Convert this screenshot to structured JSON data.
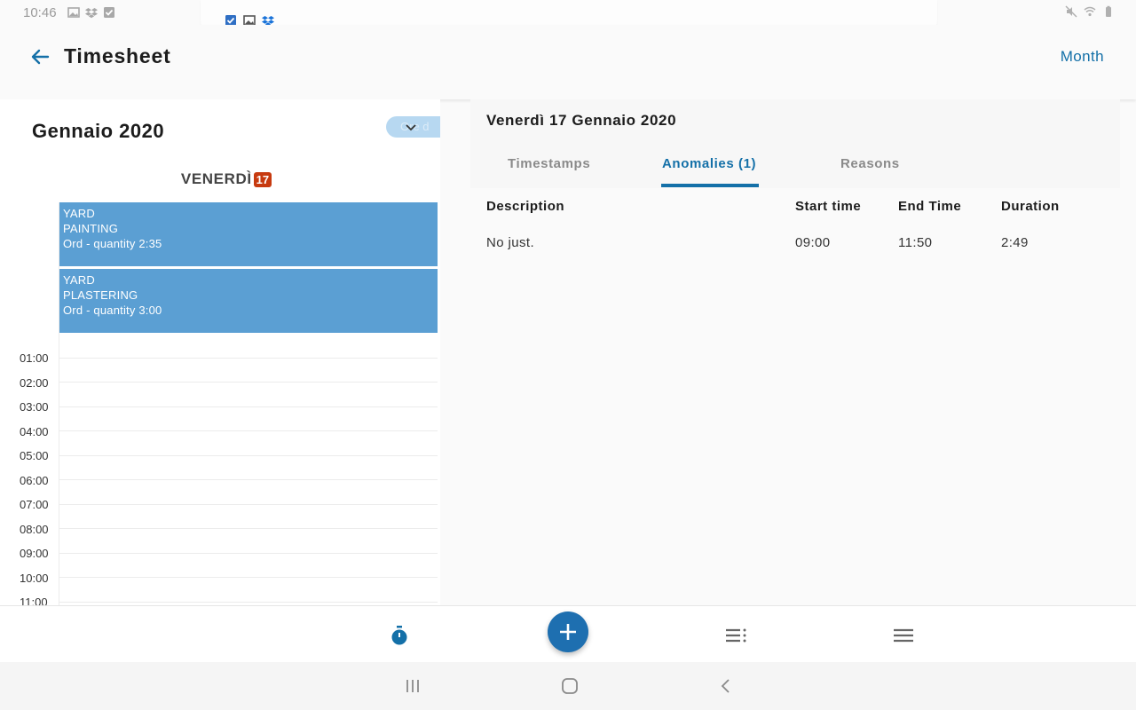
{
  "status_bar": {
    "time": "10:46",
    "left_icons": [
      "image-icon",
      "dropbox-icon",
      "checkbox-icon"
    ],
    "notification_icons": [
      "checkbox-icon",
      "image-icon",
      "dropbox-icon"
    ],
    "right_icons": [
      "mute-icon",
      "wifi-icon",
      "battery-icon"
    ]
  },
  "header": {
    "title": "Timesheet",
    "view_mode": "Month"
  },
  "calendar": {
    "month_label": "Gennaio 2020",
    "chip_text": "Ore d",
    "day_name": "VENERDÌ",
    "day_number": "17",
    "events": [
      {
        "line1": "YARD",
        "line2": "PAINTING",
        "line3": "Ord - quantity 2:35"
      },
      {
        "line1": "YARD",
        "line2": "PLASTERING",
        "line3": "Ord - quantity 3:00"
      }
    ],
    "hours": [
      "01:00",
      "02:00",
      "03:00",
      "04:00",
      "05:00",
      "06:00",
      "07:00",
      "08:00",
      "09:00",
      "10:00",
      "11:00"
    ]
  },
  "detail": {
    "date_title": "Venerdì 17 Gennaio 2020",
    "tabs": [
      {
        "label": "Timestamps",
        "active": false
      },
      {
        "label": "Anomalies (1)",
        "active": true
      },
      {
        "label": "Reasons",
        "active": false
      }
    ],
    "columns": [
      "Description",
      "Start time",
      "End Time",
      "Duration"
    ],
    "rows": [
      {
        "description": "No just.",
        "start": "09:00",
        "end": "11:50",
        "duration": "2:49"
      }
    ]
  },
  "bottom_nav": {
    "items": [
      "stopwatch-icon",
      "add-icon",
      "list-icon",
      "menu-icon"
    ]
  },
  "colors": {
    "accent": "#1470a8",
    "event": "#5b9fd3",
    "fab": "#1e6fb0",
    "day_badge": "#c73a0f"
  }
}
